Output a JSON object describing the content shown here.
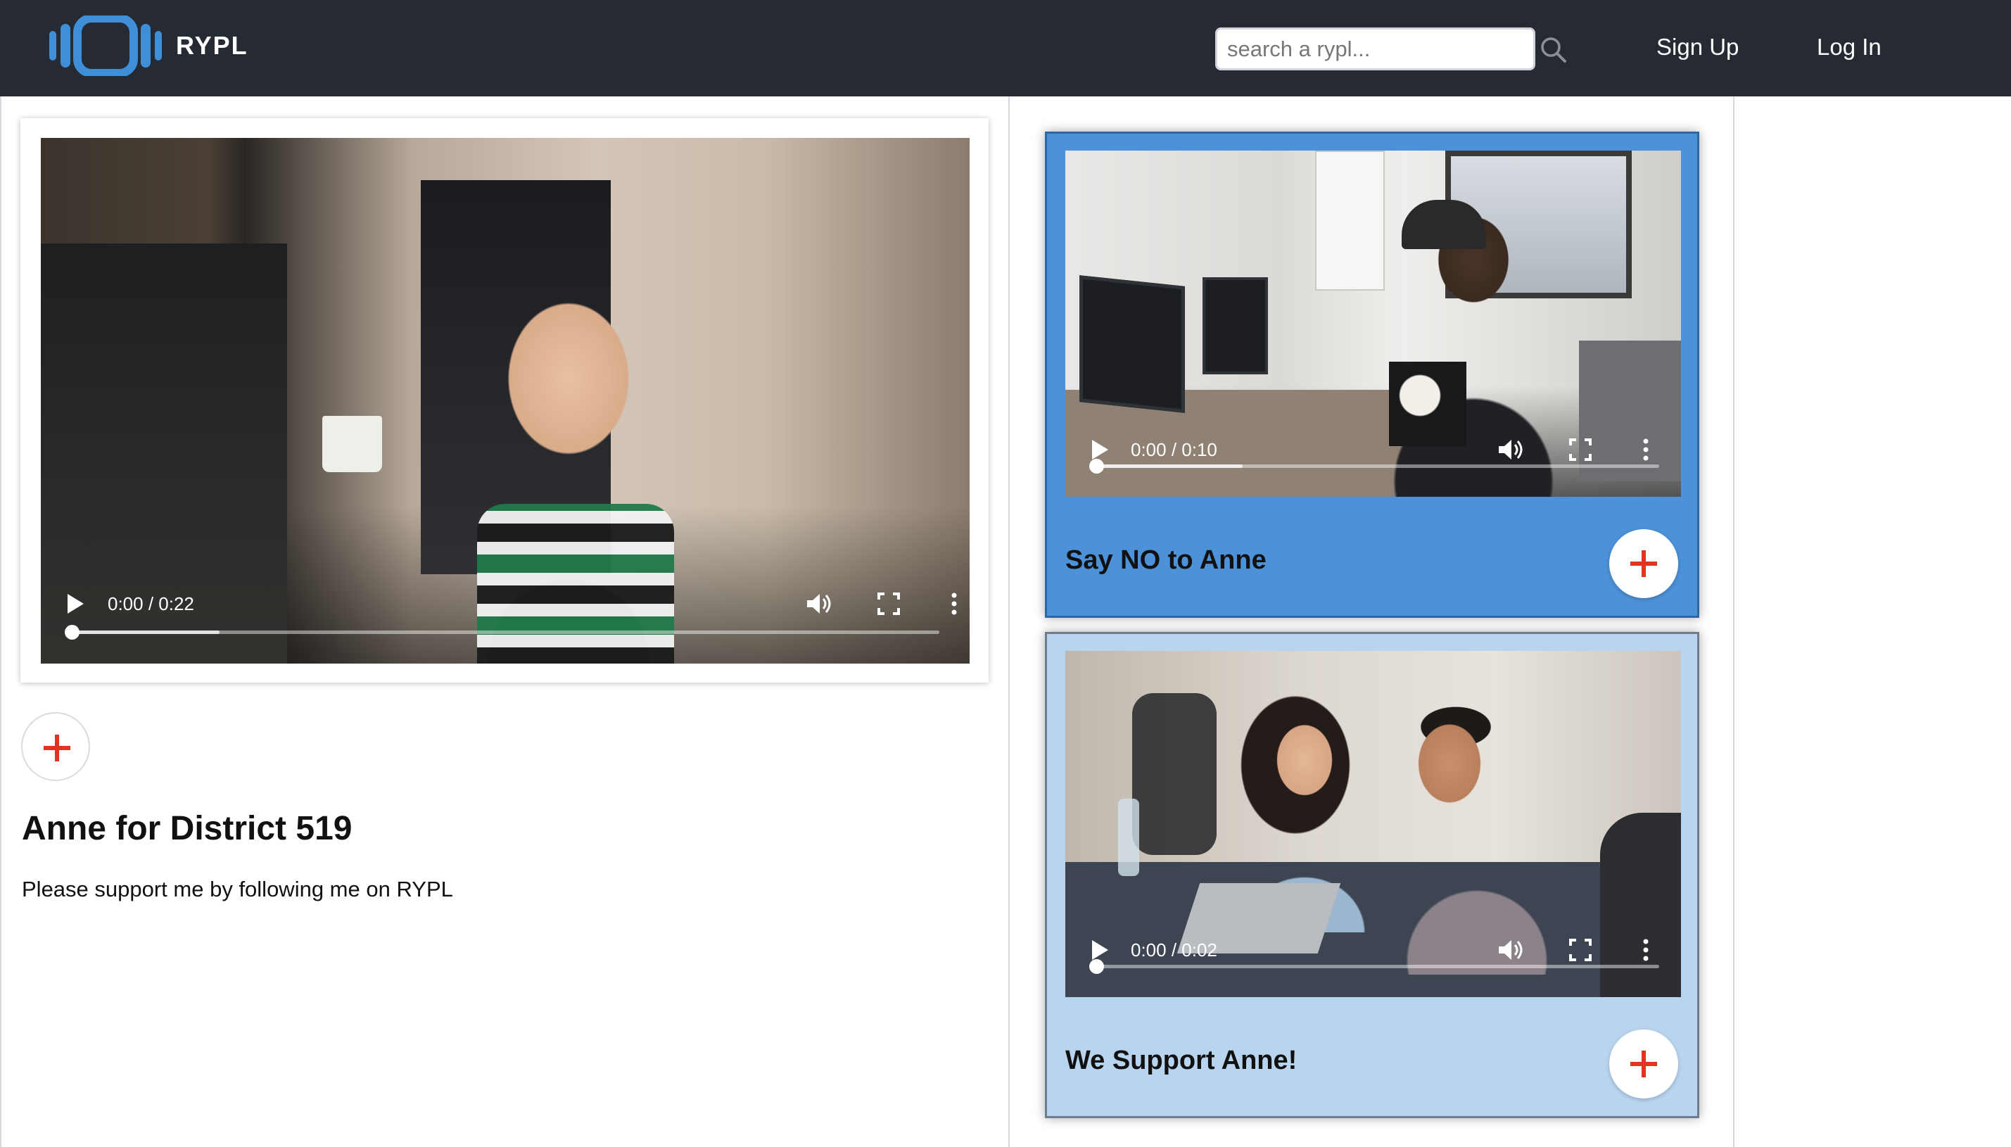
{
  "app": {
    "brand": "RYPL",
    "logo_icon": "rypl-logo-icon",
    "colors": {
      "header_bg": "#262a33",
      "card_primary_bg": "#4d91d8",
      "card_secondary_bg": "#b8d4ef",
      "plus_red": "#e0341f"
    }
  },
  "header": {
    "search": {
      "placeholder": "search a rypl...",
      "value": ""
    },
    "search_icon": "search-icon",
    "nav": {
      "signup": "Sign Up",
      "login": "Log In"
    }
  },
  "main": {
    "video": {
      "time": "0:00 / 0:22",
      "progress": 0,
      "buffered": 0.17
    },
    "title": "Anne for District 519",
    "description": "Please support me by following me on RYPL"
  },
  "responses": [
    {
      "title": "Say NO to Anne",
      "video": {
        "time": "0:00 / 0:10",
        "progress": 0,
        "buffered": 0.26
      }
    },
    {
      "title": "We Support Anne!",
      "video": {
        "time": "0:00 / 0:02",
        "progress": 0,
        "buffered": 0
      }
    }
  ]
}
